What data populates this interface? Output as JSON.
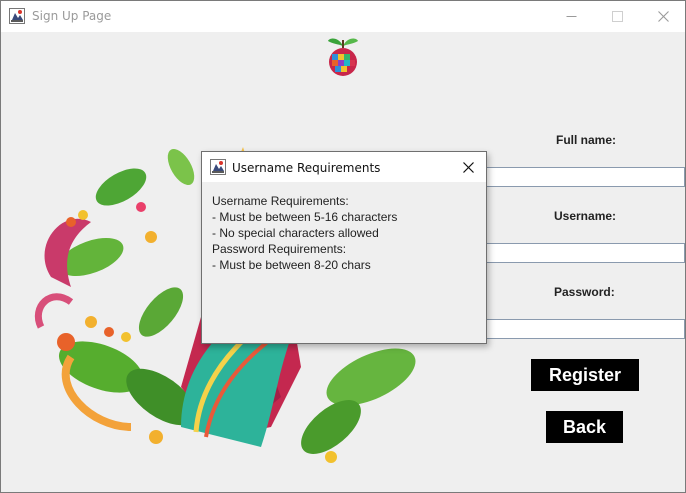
{
  "window": {
    "title": "Sign Up Page",
    "controls": {
      "minimize": "minimize",
      "maximize": "maximize",
      "close": "close"
    }
  },
  "form": {
    "full_name_label": "Full name:",
    "full_name_value": "",
    "username_label": "Username:",
    "username_value": "",
    "password_label": "Password:",
    "password_value": ""
  },
  "buttons": {
    "register": "Register",
    "back": "Back"
  },
  "dialog": {
    "title": "Username Requirements",
    "lines": [
      "Username Requirements:",
      "- Must be between 5-16 characters",
      "- No special characters allowed",
      "Password Requirements:",
      "- Must be between 8-20 chars"
    ]
  },
  "colors": {
    "window_bg": "#efefef",
    "button_bg": "#000000",
    "button_text": "#ffffff",
    "field_border": "#8a9aae"
  },
  "icons": [
    "java-app-icon",
    "minimize-icon",
    "maximize-icon",
    "close-icon",
    "apple-logo-icon",
    "decorative-artwork"
  ]
}
